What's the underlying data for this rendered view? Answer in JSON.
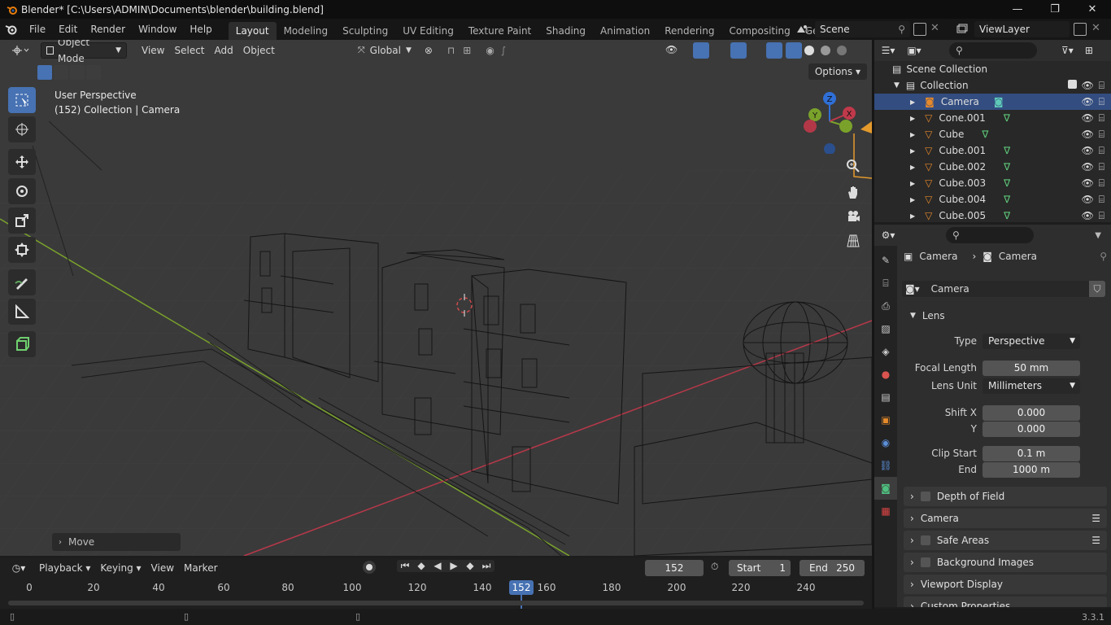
{
  "window": {
    "title": "Blender* [C:\\Users\\ADMIN\\Documents\\blender\\building.blend]",
    "minimize": "—",
    "restore": "❐",
    "close": "✕"
  },
  "menubar": {
    "items": [
      "File",
      "Edit",
      "Render",
      "Window",
      "Help"
    ],
    "workspaces": [
      "Layout",
      "Modeling",
      "Sculpting",
      "UV Editing",
      "Texture Paint",
      "Shading",
      "Animation",
      "Rendering",
      "Compositing",
      "Geometry Noc"
    ],
    "active_workspace": "Layout",
    "scene": "Scene",
    "view_layer": "ViewLayer"
  },
  "viewport": {
    "mode": "Object Mode",
    "menus": [
      "View",
      "Select",
      "Add",
      "Object"
    ],
    "orientation": "Global",
    "options": "Options",
    "view_name": "User Perspective",
    "view_info": "(152) Collection | Camera",
    "last_operator": "Move",
    "gizmo_axes": [
      "Z",
      "Y",
      "X"
    ]
  },
  "outliner": {
    "root": "Scene Collection",
    "collection": "Collection",
    "objects": [
      {
        "name": "Camera",
        "selected": true
      },
      {
        "name": "Cone.001",
        "selected": false
      },
      {
        "name": "Cube",
        "selected": false
      },
      {
        "name": "Cube.001",
        "selected": false
      },
      {
        "name": "Cube.002",
        "selected": false
      },
      {
        "name": "Cube.003",
        "selected": false
      },
      {
        "name": "Cube.004",
        "selected": false
      },
      {
        "name": "Cube.005",
        "selected": false
      }
    ]
  },
  "properties": {
    "breadcrumb_object": "Camera",
    "breadcrumb_data": "Camera",
    "datablock": "Camera",
    "lens_panel": "Lens",
    "type_label": "Type",
    "type_value": "Perspective",
    "focal_label": "Focal Length",
    "focal_value": "50 mm",
    "lens_unit_label": "Lens Unit",
    "lens_unit_value": "Millimeters",
    "shift_x_label": "Shift X",
    "shift_x_value": "0.000",
    "shift_y_label": "Y",
    "shift_y_value": "0.000",
    "clip_start_label": "Clip Start",
    "clip_start_value": "0.1 m",
    "clip_end_label": "End",
    "clip_end_value": "1000 m",
    "panels": [
      "Depth of Field",
      "Camera",
      "Safe Areas",
      "Background Images",
      "Viewport Display",
      "Custom Properties"
    ]
  },
  "timeline": {
    "menus": [
      "Playback",
      "Keying",
      "View",
      "Marker"
    ],
    "current_frame": "152",
    "start_label": "Start",
    "start_value": "1",
    "end_label": "End",
    "end_value": "250",
    "ruler": [
      "0",
      "20",
      "40",
      "60",
      "80",
      "100",
      "120",
      "140",
      "160",
      "180",
      "200",
      "220",
      "240"
    ],
    "frame_badge": "152"
  },
  "statusbar": {
    "version": "3.3.1"
  },
  "colors": {
    "accent": "#4772b3",
    "selected_row": "#334d80",
    "x_axis": "#c0394a",
    "y_axis": "#7aa22b",
    "z_axis": "#2f6fd6"
  }
}
